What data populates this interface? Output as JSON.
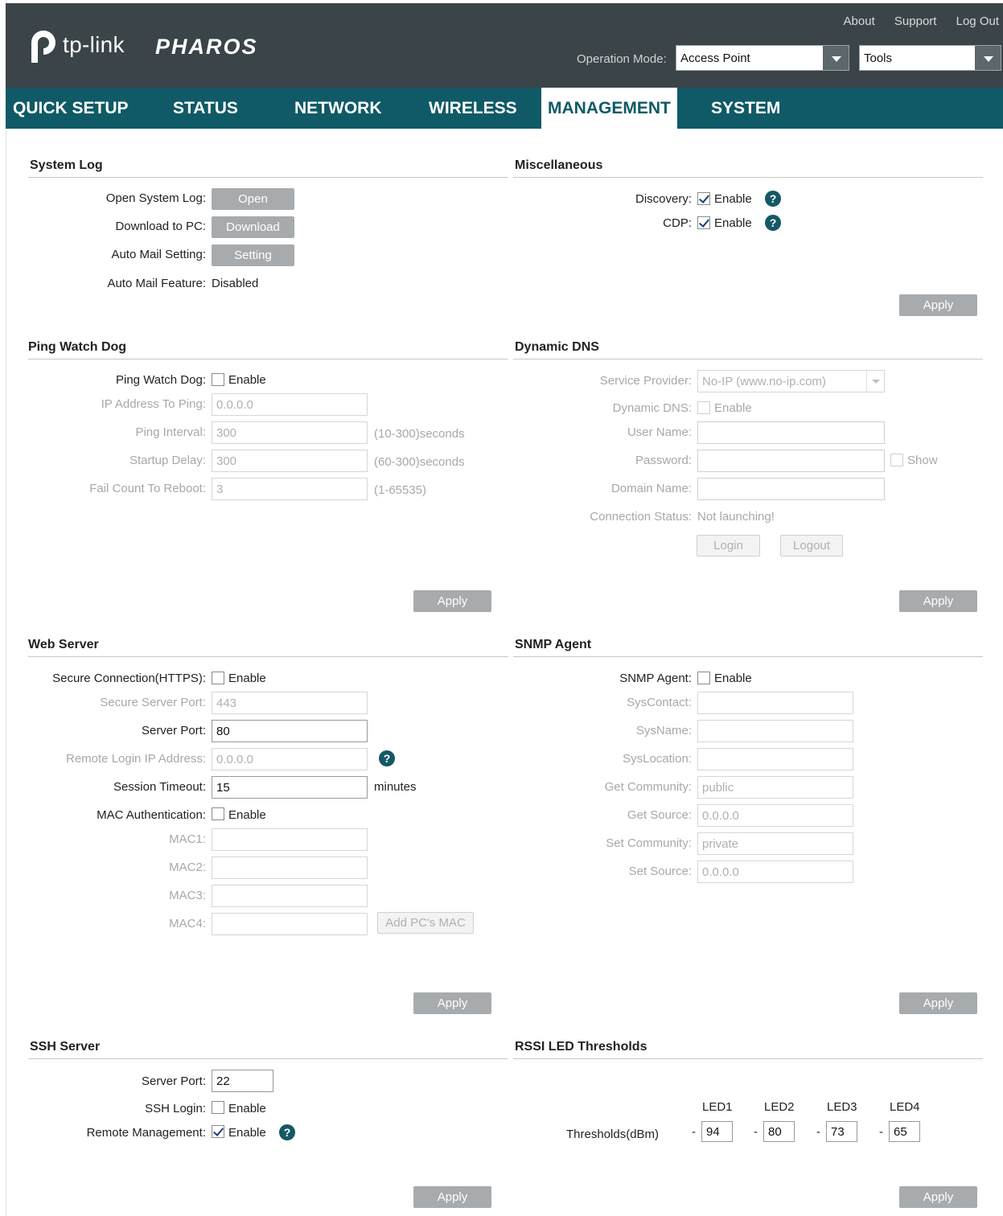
{
  "header": {
    "brand": "tp-link",
    "product": "PHAROS",
    "links": {
      "about": "About",
      "support": "Support",
      "logout": "Log Out"
    },
    "operation_mode_label": "Operation Mode:",
    "operation_mode_value": "Access Point",
    "tools_value": "Tools"
  },
  "nav": {
    "tabs": [
      "QUICK SETUP",
      "STATUS",
      "NETWORK",
      "WIRELESS",
      "MANAGEMENT",
      "SYSTEM"
    ],
    "active": "MANAGEMENT"
  },
  "system_log": {
    "title": "System Log",
    "open_label": "Open System Log:",
    "open_button": "Open",
    "download_label": "Download to PC:",
    "download_button": "Download",
    "mail_label": "Auto Mail Setting:",
    "mail_button": "Setting",
    "feature_label": "Auto Mail Feature:",
    "feature_value": "Disabled"
  },
  "misc": {
    "title": "Miscellaneous",
    "discovery_label": "Discovery:",
    "discovery_enable": "Enable",
    "cdp_label": "CDP:",
    "cdp_enable": "Enable",
    "apply": "Apply"
  },
  "ping": {
    "title": "Ping Watch Dog",
    "watchdog_label": "Ping Watch Dog:",
    "watchdog_enable": "Enable",
    "ip_label": "IP Address To Ping:",
    "ip_value": "0.0.0.0",
    "interval_label": "Ping Interval:",
    "interval_value": "300",
    "interval_hint": "(10-300)seconds",
    "startup_label": "Startup Delay:",
    "startup_value": "300",
    "startup_hint": "(60-300)seconds",
    "fail_label": "Fail Count To Reboot:",
    "fail_value": "3",
    "fail_hint": "(1-65535)",
    "apply": "Apply"
  },
  "ddns": {
    "title": "Dynamic DNS",
    "provider_label": "Service Provider:",
    "provider_value": "No-IP (www.no-ip.com)",
    "ddns_label": "Dynamic DNS:",
    "ddns_enable": "Enable",
    "user_label": "User Name:",
    "password_label": "Password:",
    "show": "Show",
    "domain_label": "Domain Name:",
    "status_label": "Connection Status:",
    "status_value": "Not launching!",
    "login": "Login",
    "logout": "Logout",
    "apply": "Apply"
  },
  "web": {
    "title": "Web Server",
    "https_label": "Secure Connection(HTTPS):",
    "https_enable": "Enable",
    "secure_port_label": "Secure Server Port:",
    "secure_port_value": "443",
    "port_label": "Server Port:",
    "port_value": "80",
    "remote_ip_label": "Remote Login IP Address:",
    "remote_ip_value": "0.0.0.0",
    "timeout_label": "Session Timeout:",
    "timeout_value": "15",
    "timeout_unit": "minutes",
    "mac_auth_label": "MAC Authentication:",
    "mac_auth_enable": "Enable",
    "mac1_label": "MAC1:",
    "mac2_label": "MAC2:",
    "mac3_label": "MAC3:",
    "mac4_label": "MAC4:",
    "add_mac": "Add PC's MAC",
    "apply": "Apply"
  },
  "snmp": {
    "title": "SNMP Agent",
    "agent_label": "SNMP Agent:",
    "agent_enable": "Enable",
    "contact_label": "SysContact:",
    "name_label": "SysName:",
    "location_label": "SysLocation:",
    "get_comm_label": "Get Community:",
    "get_comm_value": "public",
    "get_src_label": "Get Source:",
    "get_src_value": "0.0.0.0",
    "set_comm_label": "Set Community:",
    "set_comm_value": "private",
    "set_src_label": "Set Source:",
    "set_src_value": "0.0.0.0",
    "apply": "Apply"
  },
  "ssh": {
    "title": "SSH Server",
    "port_label": "Server Port:",
    "port_value": "22",
    "login_label": "SSH Login:",
    "login_enable": "Enable",
    "remote_label": "Remote Management:",
    "remote_enable": "Enable",
    "apply": "Apply"
  },
  "rssi": {
    "title": "RSSI LED Thresholds",
    "thresholds_label": "Thresholds(dBm)",
    "leds": [
      "LED1",
      "LED2",
      "LED3",
      "LED4"
    ],
    "sign": "-",
    "values": [
      "94",
      "80",
      "73",
      "65"
    ],
    "apply": "Apply"
  },
  "help_glyph": "?",
  "colors": {
    "header_bg": "#3b4448",
    "nav_bg": "#0f5a66",
    "button_bg": "#a7abad",
    "help_bg": "#155866"
  }
}
